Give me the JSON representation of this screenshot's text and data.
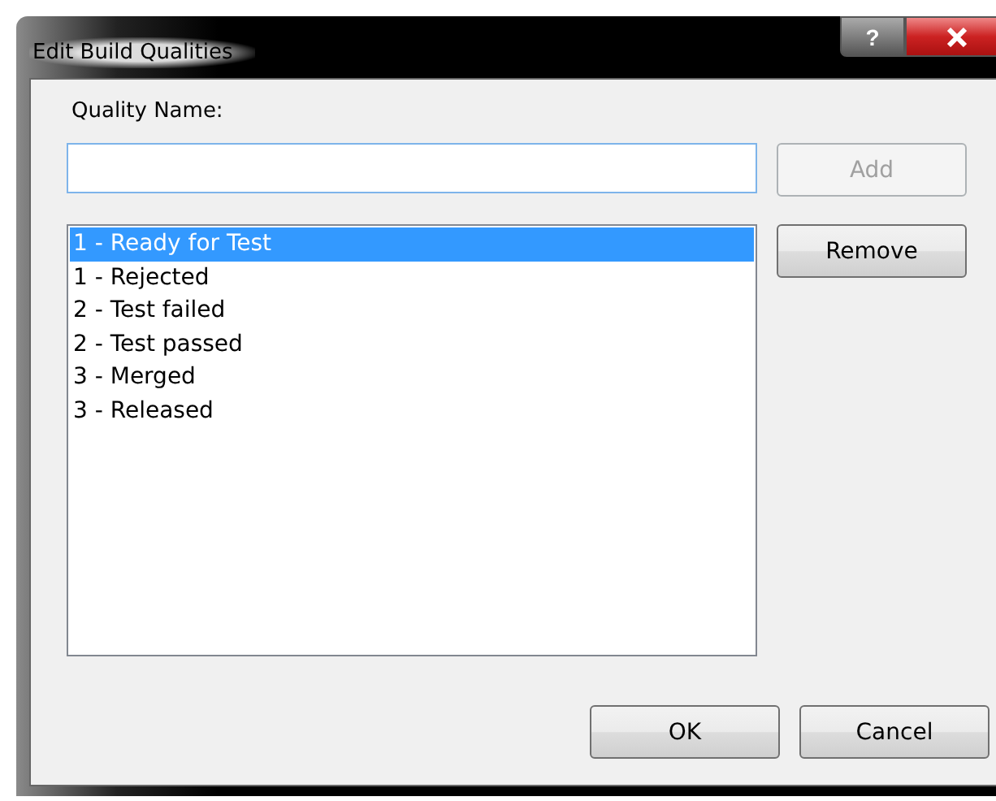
{
  "window": {
    "title": "Edit Build Qualities",
    "help_button": "?"
  },
  "quality_name": {
    "label": "Quality Name:"
  },
  "add_button": {
    "label": "Add",
    "disabled": true
  },
  "remove_button": {
    "label": "Remove",
    "disabled": false
  },
  "qualities": [
    {
      "label": "1 - Ready for Test",
      "selected": true
    },
    {
      "label": "1 - Rejected",
      "selected": false
    },
    {
      "label": "2 - Test failed",
      "selected": false
    },
    {
      "label": "2 - Test passed",
      "selected": false
    },
    {
      "label": "3 - Merged",
      "selected": false
    },
    {
      "label": "3 - Released",
      "selected": false
    }
  ],
  "buttons": [
    "OK",
    "Cancel"
  ]
}
